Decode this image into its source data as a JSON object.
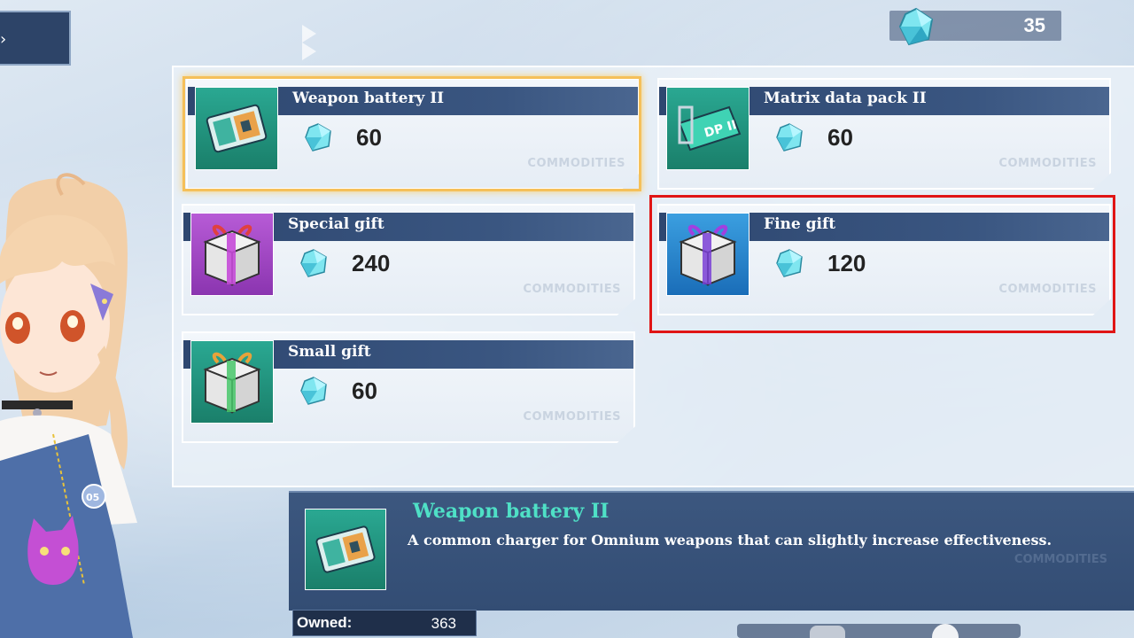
{
  "app": {
    "back_glyph": "›"
  },
  "currency": {
    "amount": "35",
    "icon": "crystal-gem-icon"
  },
  "shop": {
    "watermark": "COMMODITIES",
    "items": [
      {
        "name": "Weapon battery II",
        "price": "60",
        "icon": "weapon-battery-icon",
        "color": "#2aa892",
        "selected": true
      },
      {
        "name": "Matrix data pack II",
        "price": "60",
        "icon": "data-pack-icon",
        "badge": "DP II",
        "color": "#2aa892",
        "selected": false
      },
      {
        "name": "Special gift",
        "price": "240",
        "icon": "gift-box-icon",
        "color": "#b75bd6",
        "selected": false
      },
      {
        "name": "Fine gift",
        "price": "120",
        "icon": "gift-box-icon",
        "color": "#3b9fe0",
        "selected": false
      },
      {
        "name": "Small gift",
        "price": "60",
        "icon": "gift-box-icon",
        "color": "#2aa892",
        "selected": false
      }
    ]
  },
  "detail": {
    "title": "Weapon battery II",
    "description": "A common charger for Omnium weapons that can slightly increase effectiveness.",
    "owned_label": "Owned:",
    "owned_value": "363",
    "watermark": "COMMODITIES"
  },
  "character": {
    "badge": "05"
  },
  "colors": {
    "accent_teal": "#4fe0c6",
    "title_bar": "#2e4770",
    "selected_border": "#f5c05a",
    "highlight_border": "#e01515"
  }
}
